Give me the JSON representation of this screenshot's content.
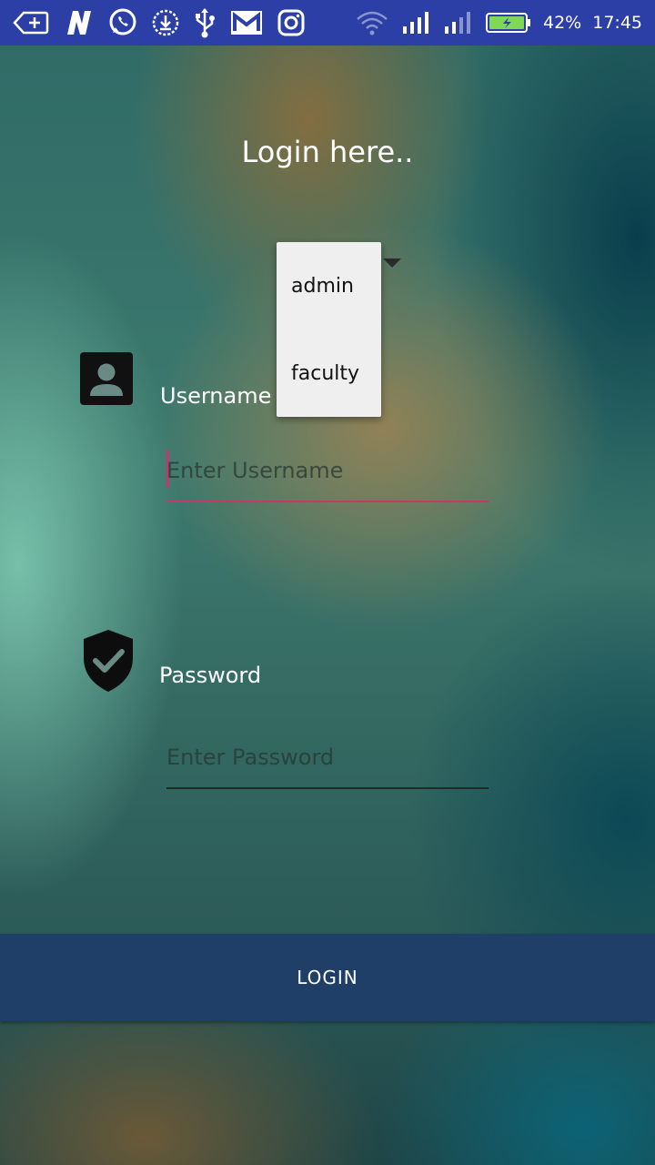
{
  "status_bar": {
    "battery_percent": "42%",
    "time": "17:45",
    "left_icons": [
      "add-call-icon",
      "n-app-icon",
      "whatsapp-icon",
      "download-icon",
      "usb-icon",
      "gmail-icon",
      "instagram-icon"
    ],
    "right_icons": [
      "wifi-icon",
      "signal-icon",
      "signal-icon-2",
      "battery-icon"
    ]
  },
  "title": "Login here..",
  "role_spinner": {
    "options": [
      "admin",
      "faculty"
    ]
  },
  "username": {
    "label": "Username",
    "placeholder": "Enter Username",
    "icon": "account-box-icon"
  },
  "password": {
    "label": "Password",
    "placeholder": "Enter Password",
    "icon": "shield-check-icon"
  },
  "login_button": {
    "label": "LOGIN"
  },
  "colors": {
    "status_bar": "#2c3fa6",
    "button": "#1f3f68",
    "accent": "#c4386a"
  }
}
